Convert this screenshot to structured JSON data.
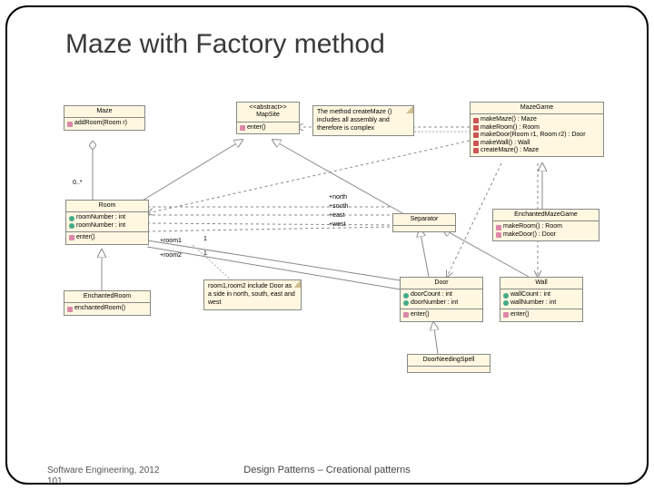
{
  "title": "Maze with Factory method",
  "footer": {
    "left": "Software Engineering, 2012",
    "center": "Design Patterns – Creational patterns",
    "slidenum": "101"
  },
  "notes": {
    "createMaze": "The method createMaze () includes all assembly and therefore is complex",
    "roomIncludes": "room1,room2 include Door as a side in north, south, east and west"
  },
  "labels": {
    "multiplicity": "0..*",
    "one": "1",
    "room1": "+room1",
    "room2": "+room2",
    "north": "+north",
    "south": "+south",
    "east": "+east",
    "west": "+west"
  },
  "classes": {
    "Maze": {
      "name": "Maze",
      "ops": [
        "addRoom(Room r)"
      ]
    },
    "MapSite": {
      "stereotype": "<<abstract>>",
      "name": "MapSite",
      "ops": [
        "enter()"
      ]
    },
    "MazeGame": {
      "name": "MazeGame",
      "ops": [
        "makeMaze() : Maze",
        "makeRoom() : Room",
        "makeDoor(Room r1, Room r2) : Door",
        "makeWall() : Wall",
        "createMaze() : Maze"
      ]
    },
    "Room": {
      "name": "Room",
      "attrs": [
        "roomNumber : int",
        "roomNumber : int"
      ],
      "ops": [
        "enter()"
      ]
    },
    "Separator": {
      "name": "Separator"
    },
    "EnchantedMazeGame": {
      "name": "EnchantedMazeGame",
      "ops": [
        "makeRoom() : Room",
        "makeDoor() : Door"
      ]
    },
    "EnchantedRoom": {
      "name": "EnchantedRoom",
      "ops": [
        "enchantedRoom()"
      ]
    },
    "Door": {
      "name": "Door",
      "attrs": [
        "doorCount : int",
        "doorNumber : int"
      ],
      "ops": [
        "enter()"
      ]
    },
    "Wall": {
      "name": "Wall",
      "attrs": [
        "wallCount : int",
        "wallNumber : int"
      ],
      "ops": [
        "enter()"
      ]
    },
    "DoorNeedingSpell": {
      "name": "DoorNeedingSpell"
    }
  },
  "chart_data": {
    "type": "uml-class-diagram",
    "classes": [
      {
        "name": "Maze",
        "operations": [
          "addRoom(Room r)"
        ]
      },
      {
        "name": "MapSite",
        "stereotype": "abstract",
        "operations": [
          "enter()"
        ]
      },
      {
        "name": "MazeGame",
        "operations": [
          "makeMaze():Maze",
          "makeRoom():Room",
          "makeDoor(Room,Room):Door",
          "makeWall():Wall",
          "createMaze():Maze"
        ]
      },
      {
        "name": "Room",
        "attributes": [
          "roomNumber:int",
          "roomNumber:int"
        ],
        "operations": [
          "enter()"
        ]
      },
      {
        "name": "Separator"
      },
      {
        "name": "EnchantedMazeGame",
        "operations": [
          "makeRoom():Room",
          "makeDoor():Door"
        ]
      },
      {
        "name": "EnchantedRoom",
        "operations": [
          "enchantedRoom()"
        ]
      },
      {
        "name": "Door",
        "attributes": [
          "doorCount:int",
          "doorNumber:int"
        ],
        "operations": [
          "enter()"
        ]
      },
      {
        "name": "Wall",
        "attributes": [
          "wallCount:int",
          "wallNumber:int"
        ],
        "operations": [
          "enter()"
        ]
      },
      {
        "name": "DoorNeedingSpell"
      }
    ],
    "relationships": [
      {
        "from": "Maze",
        "to": "Room",
        "type": "aggregation",
        "multiplicity": "0..*"
      },
      {
        "from": "Room",
        "to": "MapSite",
        "type": "generalization"
      },
      {
        "from": "Separator",
        "to": "MapSite",
        "type": "generalization"
      },
      {
        "from": "Door",
        "to": "Separator",
        "type": "generalization"
      },
      {
        "from": "Wall",
        "to": "Separator",
        "type": "generalization"
      },
      {
        "from": "EnchantedRoom",
        "to": "Room",
        "type": "generalization"
      },
      {
        "from": "DoorNeedingSpell",
        "to": "Door",
        "type": "generalization"
      },
      {
        "from": "EnchantedMazeGame",
        "to": "MazeGame",
        "type": "generalization"
      },
      {
        "from": "Room",
        "to": "Door",
        "type": "association",
        "ends": [
          "+room1 1",
          "+room2 1"
        ]
      },
      {
        "from": "Room",
        "to": "Separator",
        "type": "association",
        "roles": [
          "+north",
          "+south",
          "+east",
          "+west"
        ]
      },
      {
        "from": "MazeGame",
        "to": "Maze",
        "type": "dependency"
      },
      {
        "from": "MazeGame",
        "to": "Room",
        "type": "dependency"
      },
      {
        "from": "MazeGame",
        "to": "Door",
        "type": "dependency"
      },
      {
        "from": "MazeGame",
        "to": "Wall",
        "type": "dependency"
      }
    ]
  }
}
